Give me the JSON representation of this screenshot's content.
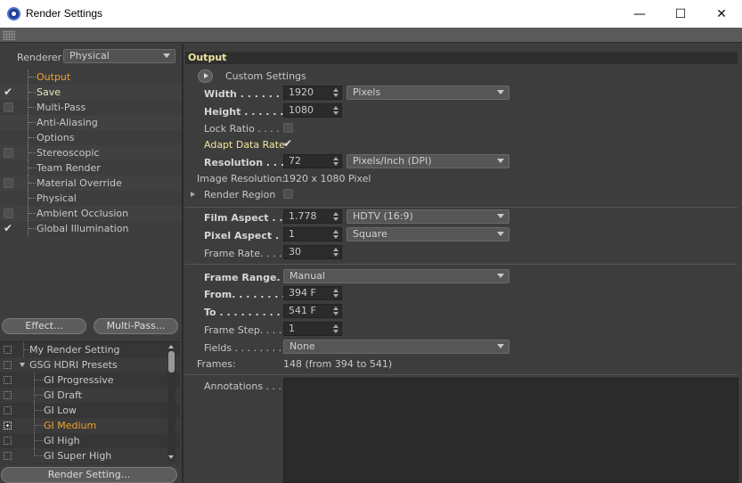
{
  "window": {
    "title": "Render Settings",
    "minimize": "—",
    "maximize": "☐",
    "close": "✕"
  },
  "left": {
    "renderer_label": "Renderer",
    "renderer_value": "Physical",
    "tree": [
      {
        "label": "Output",
        "checked": null,
        "active": true
      },
      {
        "label": "Save",
        "checked": true,
        "bold": true
      },
      {
        "label": "Multi-Pass",
        "checked": false
      },
      {
        "label": "Anti-Aliasing",
        "checked": null
      },
      {
        "label": "Options",
        "checked": null
      },
      {
        "label": "Stereoscopic",
        "checked": false
      },
      {
        "label": "Team Render",
        "checked": null
      },
      {
        "label": "Material Override",
        "checked": false
      },
      {
        "label": "Physical",
        "checked": null
      },
      {
        "label": "Ambient Occlusion",
        "checked": false
      },
      {
        "label": "Global Illumination",
        "checked": true
      }
    ],
    "effect_button": "Effect...",
    "multipass_button": "Multi-Pass...",
    "presets": [
      {
        "label": "My Render Setting",
        "level": 0
      },
      {
        "label": "GSG HDRI Presets",
        "level": 0,
        "expanded": true
      },
      {
        "label": "GI Progressive",
        "level": 1
      },
      {
        "label": "GI Draft",
        "level": 1
      },
      {
        "label": "GI Low",
        "level": 1
      },
      {
        "label": "GI Medium",
        "level": 1,
        "active": true
      },
      {
        "label": "GI High",
        "level": 1
      },
      {
        "label": "GI Super High",
        "level": 1
      }
    ],
    "render_setting_button": "Render Setting..."
  },
  "right": {
    "header": "Output",
    "custom_settings": "Custom Settings",
    "width_label": "Width . . . . . . . . .",
    "width_value": "1920",
    "width_unit": "Pixels",
    "height_label": "Height . . . . . . . .",
    "height_value": "1080",
    "lock_ratio_label": "Lock Ratio . . . . .",
    "adapt_label": "Adapt Data Rate",
    "resolution_label": "Resolution . . . . .",
    "resolution_value": "72",
    "resolution_unit": "Pixels/Inch (DPI)",
    "image_res_label": "Image Resolution:",
    "image_res_value": "1920 x 1080 Pixel",
    "render_region_label": "Render Region",
    "film_aspect_label": "Film Aspect . . . .",
    "film_aspect_value": "1.778",
    "film_aspect_preset": "HDTV (16:9)",
    "pixel_aspect_label": "Pixel Aspect . . . .",
    "pixel_aspect_value": "1",
    "pixel_aspect_preset": "Square",
    "frame_rate_label": "Frame Rate. . . . .",
    "frame_rate_value": "30",
    "frame_range_label": "Frame Range. . . .",
    "frame_range_value": "Manual",
    "from_label": "From. . . . . . . . . .",
    "from_value": "394 F",
    "to_label": "To . . . . . . . . . . . .",
    "to_value": "541 F",
    "frame_step_label": "Frame Step. . . . .",
    "frame_step_value": "1",
    "fields_label": "Fields . . . . . . . . .",
    "fields_value": "None",
    "frames_label": "Frames:",
    "frames_value": "148 (from 394 to 541)",
    "annotations_label": "Annotations . . ."
  }
}
